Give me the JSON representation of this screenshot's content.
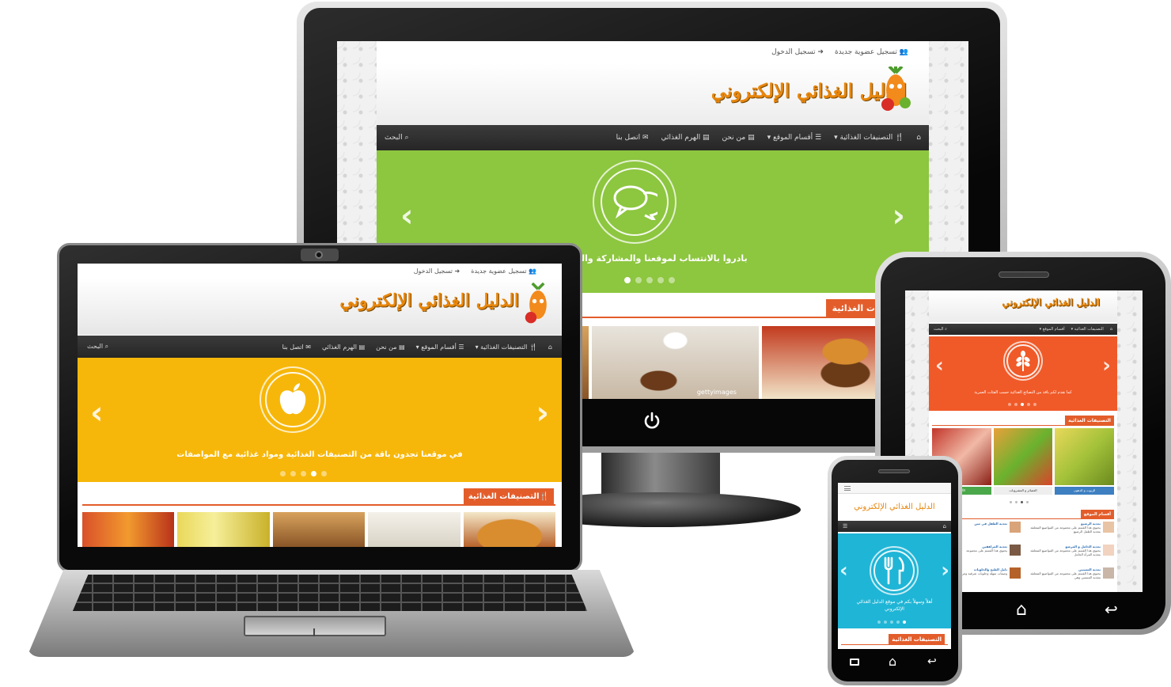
{
  "site": {
    "logo_text": "الدليل الغذائي الإلكتروني",
    "topbar": {
      "register": "تسجيل عضوية جديدة",
      "login": "تسجيل الدخول"
    },
    "nav": {
      "home_icon": "home-icon",
      "categories": "التصنيفات الغذائية",
      "sections": "أقسام الموقع",
      "about": "من نحن",
      "pyramid": "الهرم الغذائي",
      "contact": "اتصل بنا",
      "search": "البحث"
    },
    "section_title": "التصنيفات الغذائية",
    "site_sections_title": "أقسام الموقع"
  },
  "monitor": {
    "slide_caption": "بادروا بالانتساب لموقعنا والمشاركة والتعليق",
    "slide_icon": "speech-bubbles-icon",
    "slide_color": "#8dc63f",
    "dots_total": 5,
    "active_dot": 0,
    "partial_section_title": "ت الغذائية",
    "thumb_watermark": "gettyimages",
    "power_icon": "power-icon"
  },
  "laptop": {
    "slide_caption": "في موقعنا تجدون باقة من التصنيفات الغذائية ومواد غذائية مع المواصفات",
    "slide_icon": "apple-icon",
    "slide_color": "#f7b70a",
    "dots_total": 5,
    "active_dot": 3
  },
  "tablet": {
    "slide_caption": "كما نقدم لكم باقة من النصائح الغذائية حسب الفئات العمرية",
    "slide_icon": "wheat-icon",
    "slide_color": "#f05a28",
    "dots_total": 5,
    "active_dot": 2,
    "product_buttons": [
      "الزيوت و الدهون",
      "العصائر و المشروبات",
      "الألبان"
    ],
    "list_items": [
      {
        "title": "تغذية الرضيع",
        "text": "يحتوي هذا القسم على مجموعة من المواضيع المتعلقة بتغذية الطفل الرضيع"
      },
      {
        "title": "تغذية الطفل في سن",
        "text": ""
      },
      {
        "title": "تغذية الحامل و المرضع",
        "text": "يحتوي هذا القسم على مجموعة من المواضيع المتعلقة بتغذية المرأة الحامل"
      },
      {
        "title": "تغذية المراهقين",
        "text": "يحتوي هذا القسم على مجموعة"
      },
      {
        "title": "تغذية المسنين",
        "text": "يحتوي هذا القسم على مجموعة من المواضيع المتعلقة بتغذية المسنين وهي"
      },
      {
        "title": "دليل الطبخ والحلويات",
        "text": "وصفات سهلة وحلويات شرقية وغربية الأكلات و"
      }
    ],
    "home_icon": "home-icon",
    "back_icon": "back-icon"
  },
  "phone": {
    "title": "الدليل الغذائي الإلكتروني",
    "slide_caption": "أهلاً وسهلاً بكم في موقع الدليل الغذائي الإلكتروني",
    "slide_icon": "fork-knife-icon",
    "slide_color": "#1fb5d6",
    "dots_total": 5,
    "active_dot": 4,
    "home_icon": "home-icon",
    "back_icon": "back-icon",
    "recent_icon": "recent-apps-icon",
    "menu_icon": "hamburger-icon"
  }
}
